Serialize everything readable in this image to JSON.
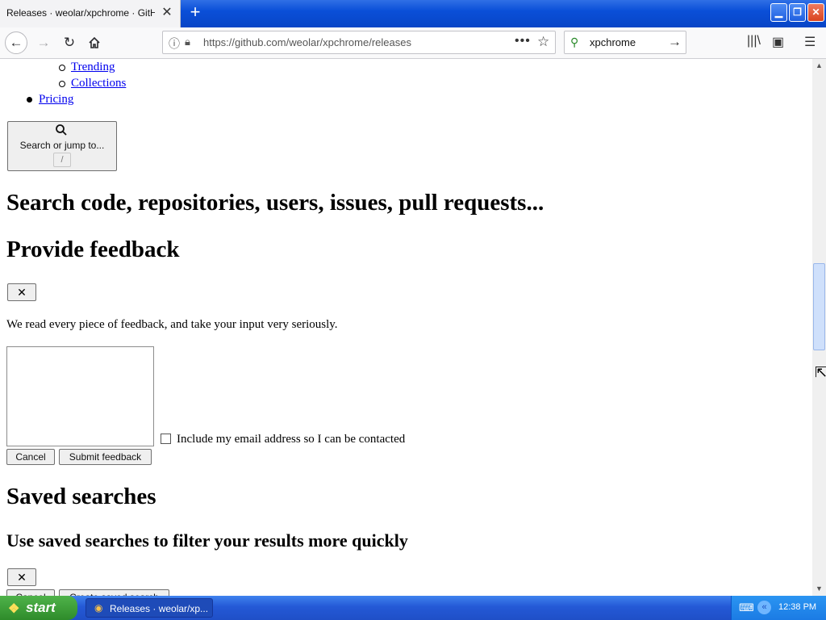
{
  "browser": {
    "tab_title": "Releases · weolar/xpchrome · GitHub",
    "tab_close": "✕",
    "new_tab": "+",
    "url": "https://github.com/weolar/xpchrome/releases",
    "url_more": "•••",
    "search_query": "xpchrome",
    "window_buttons": {
      "minimize": "▁",
      "maximize": "❐",
      "close": "✕"
    }
  },
  "page": {
    "nav_items": [
      {
        "label": "Trending"
      },
      {
        "label": "Collections"
      },
      {
        "label": "Pricing"
      }
    ],
    "jump_button": {
      "label": "Search or jump to...",
      "shortcut": "/"
    },
    "search_heading": "Search code, repositories, users, issues, pull requests...",
    "feedback": {
      "heading": "Provide feedback",
      "close_label": "✕",
      "description": "We read every piece of feedback, and take your input very seriously.",
      "textarea_value": "",
      "checkbox_label": "Include my email address so I can be contacted",
      "cancel_label": "Cancel",
      "submit_label": "Submit feedback"
    },
    "saved_searches": {
      "heading": "Saved searches",
      "subheading": "Use saved searches to filter your results more quickly",
      "close_label": "✕",
      "cancel_label": "Cancel",
      "create_label": "Create saved search"
    }
  },
  "taskbar": {
    "start_label": "start",
    "task_label": "Releases · weolar/xp...",
    "clock": "12:38 PM"
  }
}
